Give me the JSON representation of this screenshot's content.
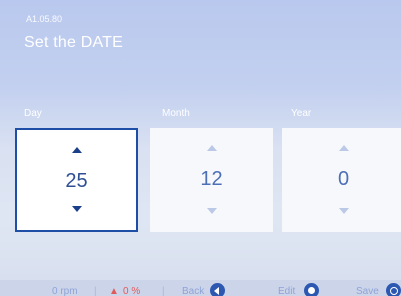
{
  "header": {
    "code": "A1.05.80",
    "title": "Set the DATE"
  },
  "fields": [
    {
      "label": "Day",
      "value": "25"
    },
    {
      "label": "Month",
      "value": "12"
    },
    {
      "label": "Year",
      "value": "0"
    }
  ],
  "footer": {
    "rpm": "0 rpm",
    "separator": "|",
    "alarm": "0 %",
    "back_label": "Back",
    "edit_label": "Edit",
    "save_label": "Save"
  }
}
